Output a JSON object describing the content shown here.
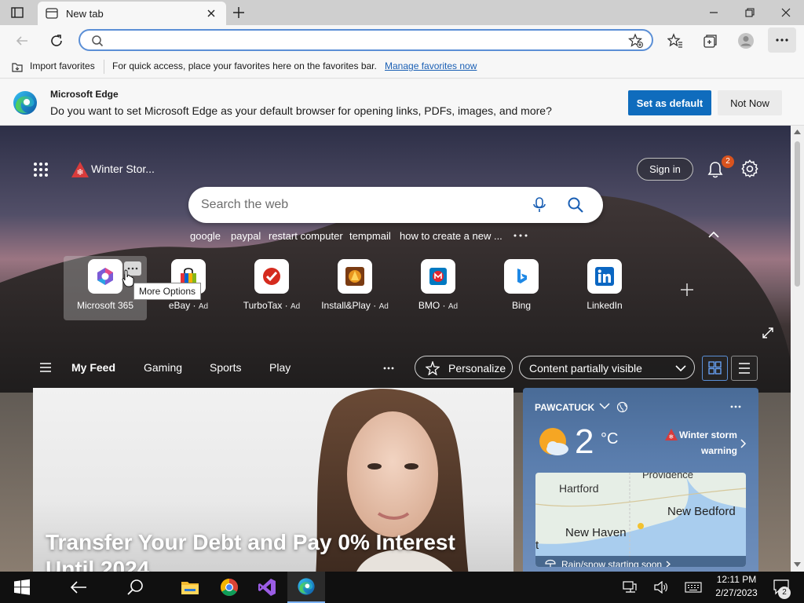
{
  "browser": {
    "tab_title": "New tab",
    "address_value": "",
    "favorites_bar": {
      "import_label": "Import favorites",
      "message": "For quick access, place your favorites here on the favorites bar.",
      "manage_link": "Manage favorites now"
    },
    "banner": {
      "title": "Microsoft Edge",
      "message": "Do you want to set Microsoft Edge as your default browser for opening links, PDFs, images, and more?",
      "set_default": "Set as default",
      "not_now": "Not Now"
    }
  },
  "newtab": {
    "alert_text": "Winter Stor...",
    "sign_in": "Sign in",
    "notification_count": "2",
    "search_placeholder": "Search the web",
    "suggestions": [
      "google",
      "paypal",
      "restart computer",
      "tempmail",
      "how to create a new ..."
    ],
    "tiles": [
      {
        "label": "Microsoft 365",
        "ad": ""
      },
      {
        "label": "eBay",
        "ad": "Ad"
      },
      {
        "label": "TurboTax",
        "ad": "Ad"
      },
      {
        "label": "Install&Play",
        "ad": "Ad"
      },
      {
        "label": "BMO",
        "ad": "Ad"
      },
      {
        "label": "Bing",
        "ad": ""
      },
      {
        "label": "LinkedIn",
        "ad": ""
      }
    ],
    "tooltip": "More Options",
    "feed_tabs": [
      "My Feed",
      "Gaming",
      "Sports",
      "Play"
    ],
    "personalize": "Personalize",
    "content_visibility": "Content partially visible",
    "headline": "Transfer Your Debt and Pay 0% Interest Until 2024",
    "weather": {
      "location": "PAWCATUCK",
      "temperature": "2",
      "unit": "°C",
      "alert_line1": "Winter storm",
      "alert_line2": "warning",
      "map_labels": [
        "Providence",
        "Hartford",
        "New Bedford",
        "New Haven",
        "t"
      ],
      "forecast_note": "Rain/snow starting soon"
    }
  },
  "taskbar": {
    "time": "12:11 PM",
    "date": "2/27/2023",
    "notification_count": "2"
  }
}
